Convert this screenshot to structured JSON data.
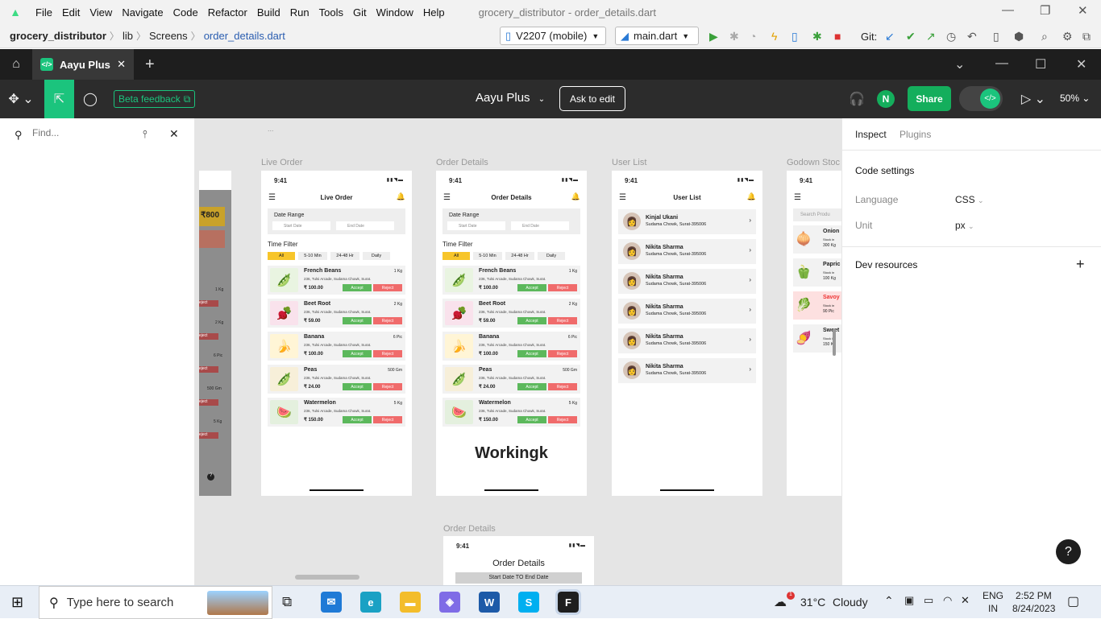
{
  "ide": {
    "menu": [
      "File",
      "Edit",
      "View",
      "Navigate",
      "Code",
      "Refactor",
      "Build",
      "Run",
      "Tools",
      "Git",
      "Window",
      "Help"
    ],
    "window_title": "grocery_distributor - order_details.dart",
    "breadcrumb": [
      "grocery_distributor",
      "lib",
      "Screens",
      "order_details.dart"
    ],
    "device": "V2207 (mobile)",
    "run_config": "main.dart",
    "git_label": "Git:"
  },
  "figma": {
    "tab_title": "Aayu Plus",
    "beta_feedback": "Beta feedback",
    "file_name": "Aayu Plus",
    "ask_to_edit": "Ask to edit",
    "avatar_initial": "N",
    "share": "Share",
    "zoom": "50%",
    "find_placeholder": "Find...",
    "canvas_dots": "...",
    "brand_color": "#1bc47d"
  },
  "frames": {
    "labels": [
      "Live Order",
      "Order Details",
      "User List",
      "Godown Stoc",
      "Order Details"
    ],
    "status_time": "9:41",
    "date_range_label": "Date Range",
    "start_date": "Start Date",
    "end_date": "End Date",
    "time_filter": "Time Filter",
    "filters": [
      "All",
      "5-10 Min",
      "24-48 Hr",
      "Daily"
    ],
    "accept": "Accept",
    "reject": "Reject",
    "live_order_title": "Live Order",
    "order_details_title": "Order Details",
    "user_list_title": "User List",
    "working_text": "Workingk",
    "bottom_frame_title": "Order Details",
    "bottom_frame_range": "Start Date TO End Date",
    "orders": [
      {
        "name": "French Beans",
        "qty": "1 Kg",
        "address": "236, Tulsi Arcade, Sudama Chowk, Surat.",
        "price": "₹ 100.00",
        "icon": "🫛",
        "bg": "#e9f4e1"
      },
      {
        "name": "Beet Root",
        "qty": "2 Kg",
        "address": "236, Tulsi Arcade, Sudama Chowk, Surat.",
        "price": "₹ 59.00",
        "icon": "🫜",
        "bg": "#f9e2ec"
      },
      {
        "name": "Banana",
        "qty": "6 Pic",
        "address": "236, Tulsi Arcade, Sudama Chowk, Surat.",
        "price": "₹ 100.00",
        "icon": "🍌",
        "bg": "#fff5d6"
      },
      {
        "name": "Peas",
        "qty": "500 Gm",
        "address": "236, Tulsi Arcade, Sudama Chowk, Surat.",
        "price": "₹ 24.00",
        "icon": "🫛",
        "bg": "#f7efd9"
      },
      {
        "name": "Watermelon",
        "qty": "5 Kg",
        "address": "236, Tulsi Arcade, Sudama Chowk, Surat.",
        "price": "₹ 150.00",
        "icon": "🍉",
        "bg": "#e4f0de"
      }
    ],
    "users": [
      {
        "name": "Kinjal Ukani",
        "address": "Sudama Chowk, Surat-395006"
      },
      {
        "name": "Nikita Sharma",
        "address": "Sudama Chowk, Surat-395006"
      },
      {
        "name": "Nikita Sharma",
        "address": "Sudama Chowk, Surat-395006"
      },
      {
        "name": "Nikita Sharma",
        "address": "Sudama Chowk, Surat-395006"
      },
      {
        "name": "Nikita Sharma",
        "address": "Sudama Chowk, Surat-395006"
      },
      {
        "name": "Nikita Sharma",
        "address": "Sudama Chowk, Surat-395006"
      }
    ],
    "godown": {
      "search": "Search Produ",
      "items": [
        {
          "name": "Onion",
          "stock": "Stock in",
          "qty": "300 Kg",
          "icon": "🧅"
        },
        {
          "name": "Papric",
          "stock": "Stock in",
          "qty": "100 Kg",
          "icon": "🫑"
        },
        {
          "name": "Savoy",
          "stock": "Stock in",
          "qty": "90 Pic",
          "icon": "🥬"
        },
        {
          "name": "Sweet",
          "stock": "Stock in",
          "qty": "150 Kg",
          "icon": "🍠"
        }
      ]
    },
    "partial_left": {
      "badge": "₹800",
      "items": [
        "1 Kg",
        "2 Kg",
        "6 Pic",
        "500 Gm",
        "5 Kg"
      ],
      "surat": "urat.",
      "reject": "eject"
    }
  },
  "inspect": {
    "tabs": [
      "Inspect",
      "Plugins"
    ],
    "code_settings": "Code settings",
    "language_label": "Language",
    "language_value": "CSS",
    "unit_label": "Unit",
    "unit_value": "px",
    "dev_resources": "Dev resources",
    "help": "?"
  },
  "taskbar": {
    "search_placeholder": "Type here to search",
    "weather_temp": "31°C",
    "weather_text": "Cloudy",
    "lang": "ENG",
    "region": "IN",
    "time": "2:52 PM",
    "date": "8/24/2023",
    "weather_badge": "1"
  }
}
